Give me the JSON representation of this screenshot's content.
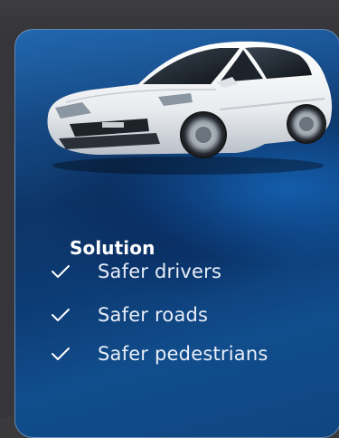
{
  "card": {
    "image_alt": "white sedan",
    "title": "Solution",
    "benefits": [
      {
        "icon": "check-icon",
        "label": "Safer drivers"
      },
      {
        "icon": "check-icon",
        "label": "Safer roads"
      },
      {
        "icon": "check-icon",
        "label": "Safer pedestrians"
      }
    ]
  },
  "colors": {
    "card_top": "#1e5d9e",
    "card_mid": "#0d3567",
    "card_accent": "#145faf",
    "page_background": "#36363a",
    "text": "#ffffff"
  }
}
